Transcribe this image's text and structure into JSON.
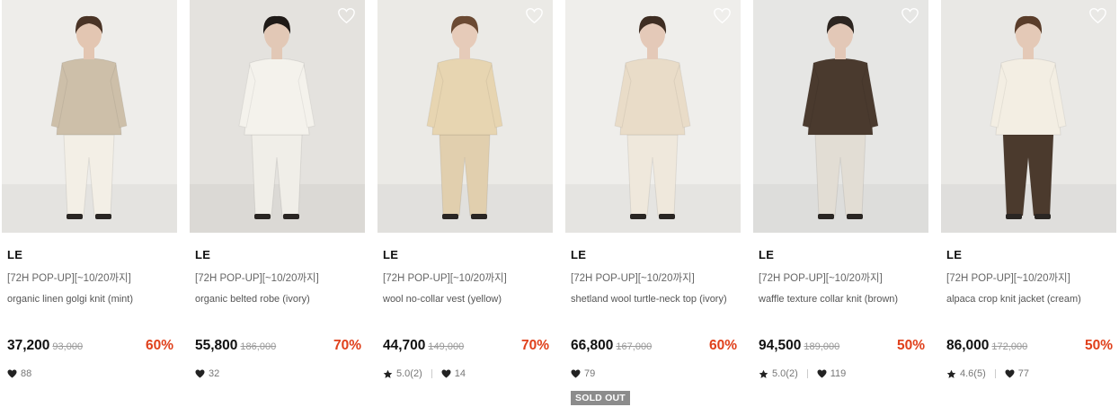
{
  "products": [
    {
      "brand": "LE",
      "promo": "[72H POP-UP][~10/20까지]",
      "name": "organic linen golgi knit (mint)",
      "price": "37,200",
      "original_price": "93,000",
      "discount": "60%",
      "likes": "88",
      "colors": {
        "bg": "#eeedea",
        "top": "#cdbfa9",
        "bottom": "#f3efe6",
        "hair": "#4a3426",
        "skin": "#e3c6b2"
      }
    },
    {
      "brand": "LE",
      "promo": "[72H POP-UP][~10/20까지]",
      "name": "organic belted robe (ivory)",
      "price": "55,800",
      "original_price": "186,000",
      "discount": "70%",
      "likes": "32",
      "colors": {
        "bg": "#e4e2de",
        "top": "#f4f2ec",
        "bottom": "#f0eee8",
        "hair": "#1f1a17",
        "skin": "#e2c8b6"
      }
    },
    {
      "brand": "LE",
      "promo": "[72H POP-UP][~10/20까지]",
      "name": "wool no-collar vest (yellow)",
      "price": "44,700",
      "original_price": "149,000",
      "discount": "70%",
      "rating": "5.0(2)",
      "likes": "14",
      "colors": {
        "bg": "#ebeae6",
        "top": "#e7d5b1",
        "bottom": "#e1cfae",
        "hair": "#6b4a33",
        "skin": "#e6cbb9"
      }
    },
    {
      "brand": "LE",
      "promo": "[72H POP-UP][~10/20까지]",
      "name": "shetland wool turtle-neck top (ivory)",
      "price": "66,800",
      "original_price": "167,000",
      "discount": "60%",
      "likes": "79",
      "sold_out": "SOLD OUT",
      "colors": {
        "bg": "#efeeeb",
        "top": "#e9dcc8",
        "bottom": "#efe8dc",
        "hair": "#3e2d22",
        "skin": "#e4c9b8"
      }
    },
    {
      "brand": "LE",
      "promo": "[72H POP-UP][~10/20까지]",
      "name": "waffle texture collar knit (brown)",
      "price": "94,500",
      "original_price": "189,000",
      "discount": "50%",
      "rating": "5.0(2)",
      "likes": "119",
      "colors": {
        "bg": "#e6e6e4",
        "top": "#4a3a2e",
        "bottom": "#e2ddd4",
        "hair": "#2d2520",
        "skin": "#e3c8b7"
      }
    },
    {
      "brand": "LE",
      "promo": "[72H POP-UP][~10/20까지]",
      "name": "alpaca crop knit jacket (cream)",
      "price": "86,000",
      "original_price": "172,000",
      "discount": "50%",
      "rating": "4.6(5)",
      "likes": "77",
      "colors": {
        "bg": "#e9e8e5",
        "top": "#f3eee3",
        "bottom": "#4b3a2d",
        "hair": "#5a3d2a",
        "skin": "#e4c9b7"
      }
    }
  ]
}
